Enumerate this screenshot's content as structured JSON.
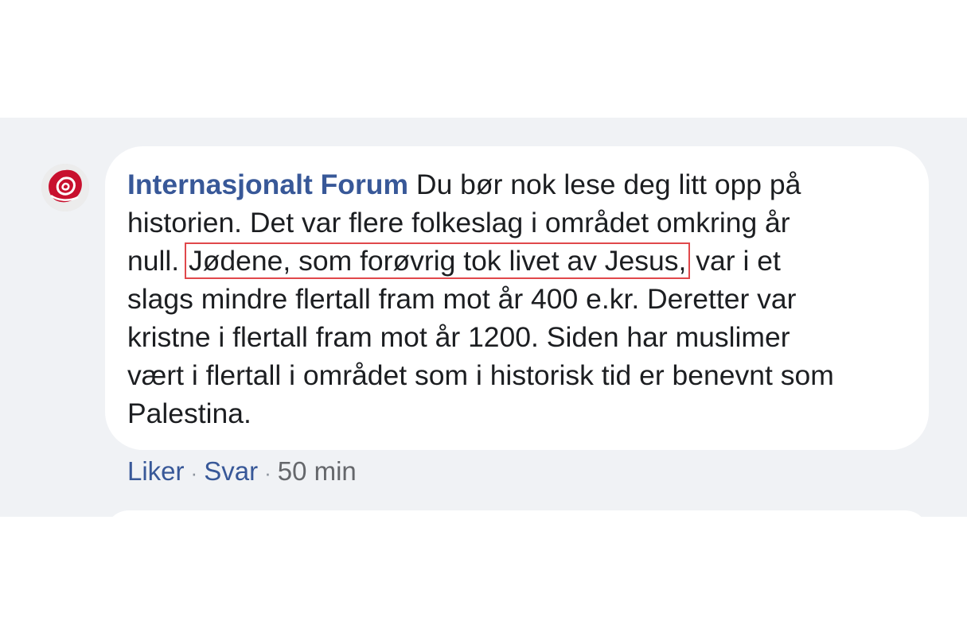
{
  "comment": {
    "author": "Internasjonalt Forum",
    "lines": [
      " Du bør nok lese deg litt opp på",
      "historien. Det var flere folkeslag i området omkring år",
      "null. ",
      "Jødene, som forøvrig tok livet av Jesus,",
      " var i et",
      "slags mindre flertall fram mot år 400 e.kr. Deretter var",
      "kristne i flertall fram mot år 1200. Siden har muslimer",
      "vært i flertall i området som i historisk tid er benevnt som",
      "Palestina."
    ]
  },
  "actions": {
    "like": "Liker",
    "reply": "Svar",
    "separator": "·",
    "time": "50 min"
  },
  "colors": {
    "author": "#385898",
    "highlight_border": "#e0484b",
    "background": "#f0f2f5"
  },
  "icons": {
    "avatar": "red-rose-logo-icon"
  }
}
